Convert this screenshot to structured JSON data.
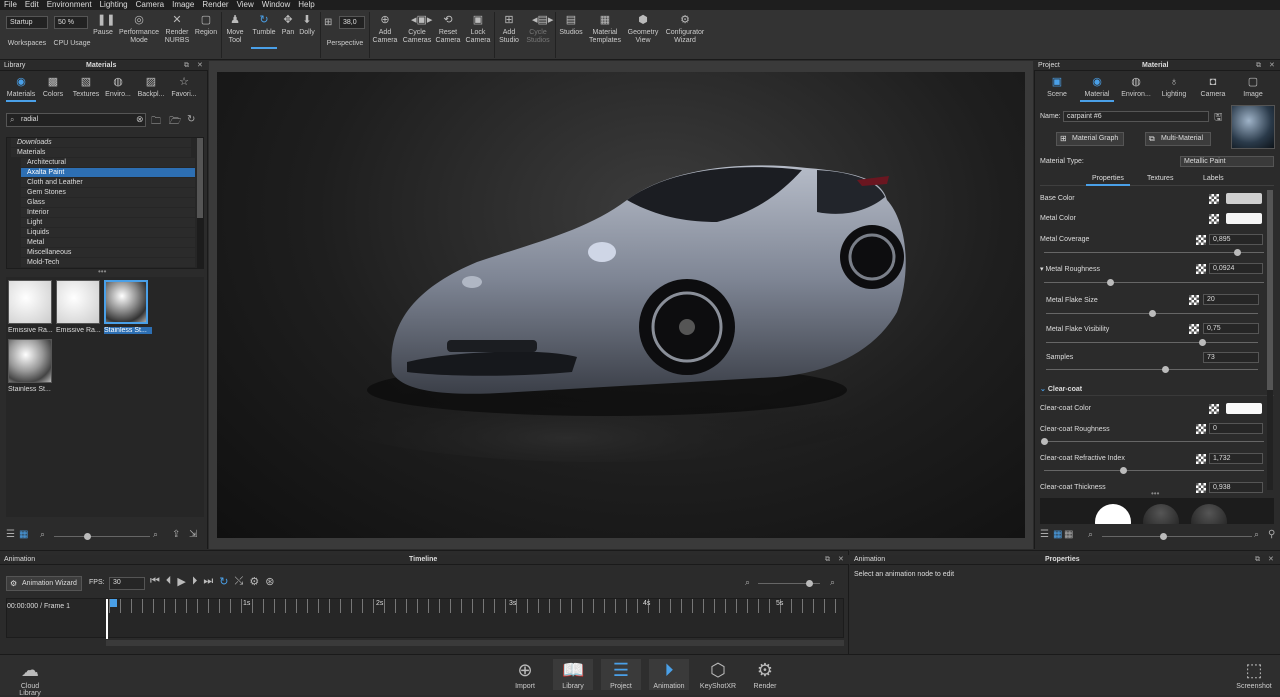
{
  "menu": [
    "File",
    "Edit",
    "Environment",
    "Lighting",
    "Camera",
    "Image",
    "Render",
    "View",
    "Window",
    "Help"
  ],
  "toolbar": {
    "startup": "Startup",
    "workspaces": "Workspaces",
    "cpu_value": "50 %",
    "cpu_usage": "CPU Usage",
    "pause": "Pause",
    "performance_mode": "Performance Mode",
    "render_nurbs": "Render NURBS",
    "region": "Region",
    "move_tool": "Move Tool",
    "tumble": "Tumble",
    "pan": "Pan",
    "dolly": "Dolly",
    "fov_value": "38,0",
    "perspective": "Perspective",
    "add_camera": "Add Camera",
    "cycle_cameras": "Cycle Cameras",
    "reset_camera": "Reset Camera",
    "lock_camera": "Lock Camera",
    "add_studio": "Add Studio",
    "cycle_studios": "Cycle Studios",
    "studios": "Studios",
    "material_templates": "Material Templates",
    "geometry_view": "Geometry View",
    "configurator_wizard": "Configurator Wizard"
  },
  "library": {
    "panel_title": "Library",
    "section_title": "Materials",
    "tabs": [
      "Materials",
      "Colors",
      "Textures",
      "Enviro...",
      "Backpl...",
      "Favori..."
    ],
    "search_value": "radial",
    "tree": [
      "Downloads",
      "Materials",
      "Architectural",
      "Axalta Paint",
      "Cloth and Leather",
      "Gem Stones",
      "Glass",
      "Interior",
      "Light",
      "Liquids",
      "Metal",
      "Miscellaneous",
      "Mold-Tech"
    ],
    "selected_tree": "Axalta Paint",
    "thumbs": [
      "Emissive Ra...",
      "Emissive Ra...",
      "Stainless St...",
      "Stainless St..."
    ]
  },
  "project": {
    "panel_title": "Project",
    "section_title": "Material",
    "tabs": [
      "Scene",
      "Material",
      "Environ...",
      "Lighting",
      "Camera",
      "Image"
    ],
    "name_label": "Name:",
    "name_value": "carpaint #6",
    "material_graph": "Material Graph",
    "multi_material": "Multi-Material",
    "material_type_label": "Material Type:",
    "material_type_value": "Metallic Paint",
    "subtabs": [
      "Properties",
      "Textures",
      "Labels"
    ],
    "base_color": "Base Color",
    "metal_color": "Metal Color",
    "metal_coverage": "Metal Coverage",
    "metal_coverage_value": "0,895",
    "metal_roughness": "Metal Roughness",
    "metal_roughness_value": "0,0924",
    "metal_flake_size": "Metal Flake Size",
    "metal_flake_size_value": "20",
    "metal_flake_visibility": "Metal Flake Visibility",
    "metal_flake_visibility_value": "0,75",
    "samples": "Samples",
    "samples_value": "73",
    "clear_coat": "Clear-coat",
    "clear_coat_color": "Clear-coat Color",
    "clear_coat_roughness": "Clear-coat Roughness",
    "clear_coat_roughness_value": "0",
    "clear_coat_ri": "Clear-coat Refractive Index",
    "clear_coat_ri_value": "1,732",
    "clear_coat_thickness": "Clear-coat Thickness",
    "clear_coat_thickness_value": "0,938"
  },
  "animation": {
    "panel_title": "Animation",
    "timeline_title": "Timeline",
    "wizard": "Animation Wizard",
    "fps_label": "FPS:",
    "fps_value": "30",
    "time_readout": "00:00:000 / Frame 1",
    "ticks": [
      "1s",
      "2s",
      "3s",
      "4s",
      "5s"
    ],
    "right_title": "Animation",
    "properties_title": "Properties",
    "hint": "Select an animation node to edit"
  },
  "bottom": {
    "cloud_library": "Cloud Library",
    "import": "Import",
    "library": "Library",
    "project": "Project",
    "animation": "Animation",
    "keyshotxr": "KeyShotXR",
    "render": "Render",
    "screenshot": "Screenshot"
  },
  "colors": {
    "accent": "#4aa0e8",
    "selected_row": "#2d6fb3"
  }
}
